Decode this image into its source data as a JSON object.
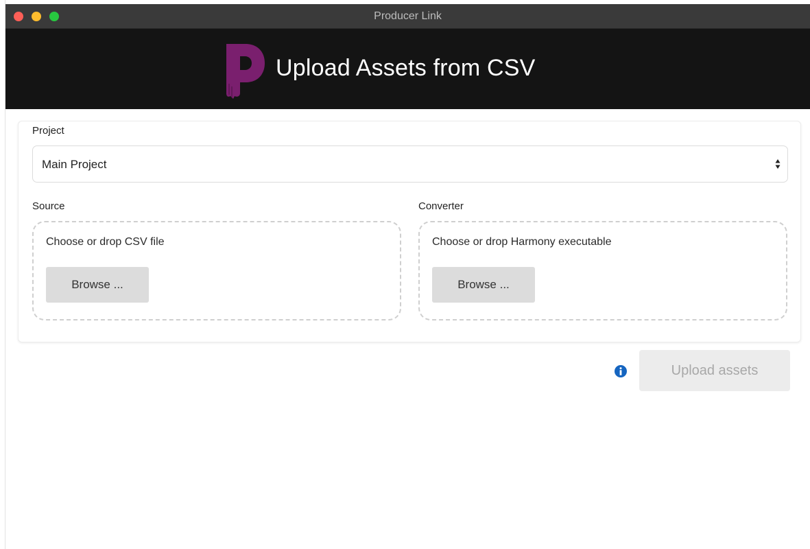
{
  "window": {
    "title": "Producer Link"
  },
  "header": {
    "logo_icon": "producer-link-p-logo",
    "title": "Upload Assets from CSV"
  },
  "form": {
    "project": {
      "label": "Project",
      "selected": "Main Project"
    },
    "source": {
      "label": "Source",
      "drop_text": "Choose or drop CSV file",
      "browse_label": "Browse ..."
    },
    "converter": {
      "label": "Converter",
      "drop_text": "Choose or drop Harmony executable",
      "browse_label": "Browse ..."
    }
  },
  "actions": {
    "info_icon": "info-icon",
    "upload_label": "Upload assets",
    "upload_enabled": false
  },
  "colors": {
    "brand_purple": "#7a1f6e",
    "header_bg": "#141414",
    "info_blue": "#1565c0",
    "close": "#fe5f57",
    "minimize": "#febc2e",
    "maximize": "#28c840"
  }
}
